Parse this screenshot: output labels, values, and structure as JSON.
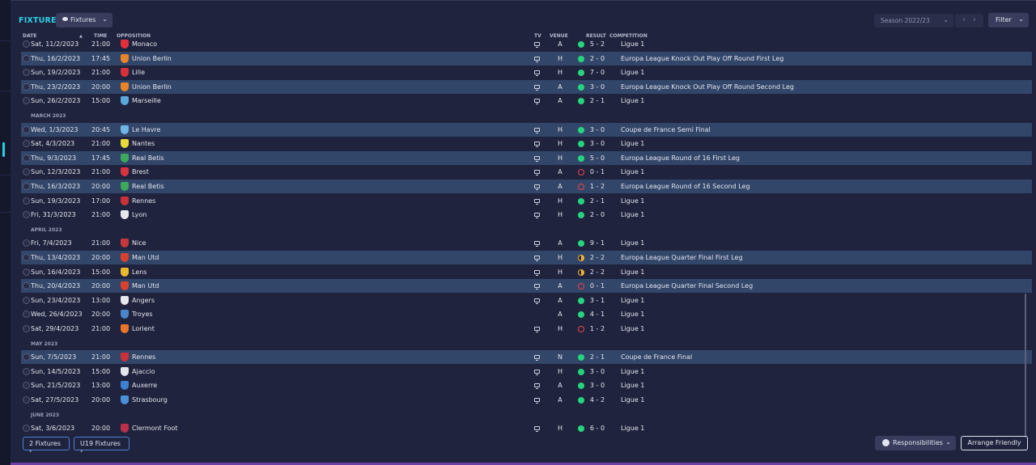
{
  "header": {
    "title": "FIXTURES",
    "view_dropdown": "Fixtures",
    "season": "Season 2022/23",
    "filter": "Filter"
  },
  "columns": {
    "date": "DATE",
    "sort_arrow": "▲",
    "time": "TIME",
    "opposition": "OPPOSITION",
    "tv": "TV",
    "venue": "VENUE",
    "result": "RESULT",
    "competition": "COMPETITION"
  },
  "rows": [
    {
      "type": "match",
      "date": "Sat, 11/2/2023",
      "time": "21:00",
      "opp": "Monaco",
      "badge": "#e0303b",
      "tv": true,
      "venue": "A",
      "res": "W",
      "score": "5 - 2",
      "comp": "Ligue 1",
      "hl": false
    },
    {
      "type": "match",
      "date": "Thu, 16/2/2023",
      "time": "17:45",
      "opp": "Union Berlin",
      "badge": "#e8852a",
      "tv": true,
      "venue": "H",
      "res": "W",
      "score": "2 - 0",
      "comp": "Europa League Knock Out Play Off Round First Leg",
      "hl": true
    },
    {
      "type": "match",
      "date": "Sun, 19/2/2023",
      "time": "21:00",
      "opp": "Lille",
      "badge": "#d6303a",
      "tv": true,
      "venue": "H",
      "res": "W",
      "score": "7 - 0",
      "comp": "Ligue 1",
      "hl": false
    },
    {
      "type": "match",
      "date": "Thu, 23/2/2023",
      "time": "20:00",
      "opp": "Union Berlin",
      "badge": "#e8852a",
      "tv": true,
      "venue": "A",
      "res": "W",
      "score": "3 - 0",
      "comp": "Europa League Knock Out Play Off Round Second Leg",
      "hl": true
    },
    {
      "type": "match",
      "date": "Sun, 26/2/2023",
      "time": "15:00",
      "opp": "Marseille",
      "badge": "#5aa9dc",
      "tv": true,
      "venue": "A",
      "res": "W",
      "score": "2 - 1",
      "comp": "Ligue 1",
      "hl": false
    },
    {
      "type": "month",
      "label": "MARCH 2023"
    },
    {
      "type": "match",
      "date": "Wed, 1/3/2023",
      "time": "20:45",
      "opp": "Le Havre",
      "badge": "#6fb5e6",
      "tv": true,
      "venue": "H",
      "res": "W",
      "score": "3 - 0",
      "comp": "Coupe de France Semi Final",
      "hl": true
    },
    {
      "type": "match",
      "date": "Sat, 4/3/2023",
      "time": "21:00",
      "opp": "Nantes",
      "badge": "#e8d93b",
      "tv": true,
      "venue": "H",
      "res": "W",
      "score": "3 - 0",
      "comp": "Ligue 1",
      "hl": false
    },
    {
      "type": "match",
      "date": "Thu, 9/3/2023",
      "time": "17:45",
      "opp": "Real Betis",
      "badge": "#3ca85a",
      "tv": true,
      "venue": "H",
      "res": "W",
      "score": "5 - 0",
      "comp": "Europa League Round of 16  First Leg",
      "hl": true
    },
    {
      "type": "match",
      "date": "Sun, 12/3/2023",
      "time": "21:00",
      "opp": "Brest",
      "badge": "#d8343f",
      "tv": true,
      "venue": "A",
      "res": "L",
      "score": "0 - 1",
      "comp": "Ligue 1",
      "hl": false
    },
    {
      "type": "match",
      "date": "Thu, 16/3/2023",
      "time": "20:00",
      "opp": "Real Betis",
      "badge": "#3ca85a",
      "tv": true,
      "venue": "A",
      "res": "L",
      "score": "1 - 2",
      "comp": "Europa League Round of 16  Second Leg",
      "hl": true
    },
    {
      "type": "match",
      "date": "Sun, 19/3/2023",
      "time": "17:00",
      "opp": "Rennes",
      "badge": "#c9323a",
      "tv": true,
      "venue": "H",
      "res": "W",
      "score": "2 - 1",
      "comp": "Ligue 1",
      "hl": false
    },
    {
      "type": "match",
      "date": "Fri, 31/3/2023",
      "time": "21:00",
      "opp": "Lyon",
      "badge": "#e6e8f0",
      "tv": true,
      "venue": "H",
      "res": "W",
      "score": "2 - 0",
      "comp": "Ligue 1",
      "hl": false
    },
    {
      "type": "month",
      "label": "APRIL 2023"
    },
    {
      "type": "match",
      "date": "Fri, 7/4/2023",
      "time": "21:00",
      "opp": "Nice",
      "badge": "#c4373b",
      "tv": true,
      "venue": "A",
      "res": "W",
      "score": "9 - 1",
      "comp": "Ligue 1",
      "hl": false
    },
    {
      "type": "match",
      "date": "Thu, 13/4/2023",
      "time": "20:00",
      "opp": "Man Utd",
      "badge": "#d9412f",
      "tv": true,
      "venue": "H",
      "res": "D",
      "score": "2 - 2",
      "comp": "Europa League Quarter Final First Leg",
      "hl": true
    },
    {
      "type": "match",
      "date": "Sun, 16/4/2023",
      "time": "15:00",
      "opp": "Lens",
      "badge": "#e8b830",
      "tv": true,
      "venue": "H",
      "res": "D",
      "score": "2 - 2",
      "comp": "Ligue 1",
      "hl": false
    },
    {
      "type": "match",
      "date": "Thu, 20/4/2023",
      "time": "20:00",
      "opp": "Man Utd",
      "badge": "#d9412f",
      "tv": true,
      "venue": "A",
      "res": "L",
      "score": "0 - 1",
      "comp": "Europa League Quarter Final Second Leg",
      "hl": true
    },
    {
      "type": "match",
      "date": "Sun, 23/4/2023",
      "time": "13:00",
      "opp": "Angers",
      "badge": "#e8e8ee",
      "tv": true,
      "venue": "A",
      "res": "W",
      "score": "3 - 1",
      "comp": "Ligue 1",
      "hl": false
    },
    {
      "type": "match",
      "date": "Wed, 26/4/2023",
      "time": "20:00",
      "opp": "Troyes",
      "badge": "#4a86c8",
      "tv": false,
      "venue": "A",
      "res": "W",
      "score": "4 - 1",
      "comp": "Ligue 1",
      "hl": false
    },
    {
      "type": "match",
      "date": "Sat, 29/4/2023",
      "time": "21:00",
      "opp": "Lorient",
      "badge": "#e8752a",
      "tv": true,
      "venue": "H",
      "res": "L",
      "score": "1 - 2",
      "comp": "Ligue 1",
      "hl": false
    },
    {
      "type": "month",
      "label": "MAY 2023"
    },
    {
      "type": "match",
      "date": "Sun, 7/5/2023",
      "time": "21:00",
      "opp": "Rennes",
      "badge": "#c9323a",
      "tv": true,
      "venue": "N",
      "res": "W",
      "score": "2 - 1",
      "comp": "Coupe de France Final",
      "hl": true
    },
    {
      "type": "match",
      "date": "Sun, 14/5/2023",
      "time": "15:00",
      "opp": "Ajaccio",
      "badge": "#e6e6ee",
      "tv": true,
      "venue": "H",
      "res": "W",
      "score": "3 - 0",
      "comp": "Ligue 1",
      "hl": false
    },
    {
      "type": "match",
      "date": "Sun, 21/5/2023",
      "time": "13:00",
      "opp": "Auxerre",
      "badge": "#3d7fd0",
      "tv": true,
      "venue": "A",
      "res": "W",
      "score": "3 - 0",
      "comp": "Ligue 1",
      "hl": false
    },
    {
      "type": "match",
      "date": "Sat, 27/5/2023",
      "time": "20:00",
      "opp": "Strasbourg",
      "badge": "#4a8fd8",
      "tv": true,
      "venue": "A",
      "res": "W",
      "score": "4 - 2",
      "comp": "Ligue 1",
      "hl": false
    },
    {
      "type": "month",
      "label": "JUNE 2023"
    },
    {
      "type": "match",
      "date": "Sat, 3/6/2023",
      "time": "20:00",
      "opp": "Clermont Foot",
      "badge": "#b9304a",
      "tv": true,
      "venue": "H",
      "res": "W",
      "score": "6 - 0",
      "comp": "Ligue 1",
      "hl": false
    }
  ],
  "footer": {
    "fixtures2": "2 Fixtures",
    "u19": "U19 Fixtures",
    "responsibilities": "Responsibilities",
    "arrange": "Arrange Friendly"
  }
}
